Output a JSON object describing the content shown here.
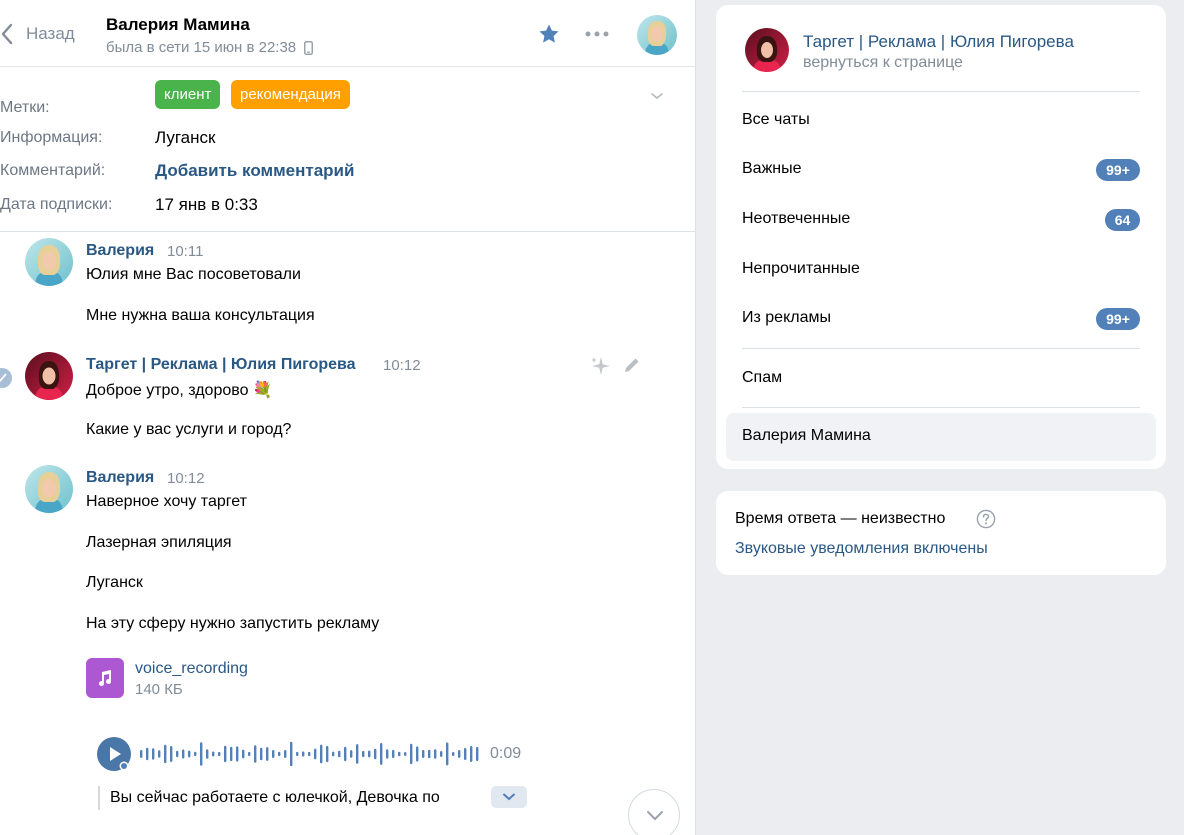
{
  "header": {
    "back_label": "Назад",
    "peer_name": "Валерия Мамина",
    "peer_status": "была в сети 15 июн в 22:38"
  },
  "meta": {
    "tags_label": "Метки:",
    "tags": [
      {
        "label": "клиент",
        "color": "#4bb34b"
      },
      {
        "label": "рекомендация",
        "color": "#ffa000"
      }
    ],
    "info_label": "Информация:",
    "info_value": "Луганск",
    "comment_label": "Комментарий:",
    "comment_link": "Добавить комментарий",
    "date_label": "Дата подписки:",
    "date_value": "17 янв в 0:33"
  },
  "messages": [
    {
      "author": "Валерия",
      "time": "10:11",
      "lines": [
        "Юлия мне Вас посоветовали",
        "Мне нужна ваша консультация"
      ]
    },
    {
      "author": "Таргет | Реклама | Юлия Пигорева",
      "time": "10:12",
      "lines": [
        "Доброе утро, здорово 💐",
        "Какие у вас услуги и город?"
      ]
    },
    {
      "author": "Валерия",
      "time": "10:12",
      "lines": [
        "Наверное хочу таргет",
        "Лазерная эпиляция",
        "Луганск",
        "На эту сферу нужно запустить рекламу"
      ],
      "attachment": {
        "name": "voice_recording",
        "size": "140 КБ",
        "icon": "music-note-icon"
      },
      "voice": {
        "duration": "0:09",
        "transcript": "Вы сейчас работаете с юлечкой, Девочка по"
      }
    }
  ],
  "sidebar": {
    "group_name": "Таргет | Реклама | Юлия Пигорева",
    "group_back": "вернуться к странице",
    "folders": [
      {
        "label": "Все чаты",
        "badge": ""
      },
      {
        "label": "Важные",
        "badge": "99+"
      },
      {
        "label": "Неотвеченные",
        "badge": "64"
      },
      {
        "label": "Непрочитанные",
        "badge": ""
      },
      {
        "label": "Из рекламы",
        "badge": "99+"
      },
      {
        "label": "Спам",
        "badge": ""
      },
      {
        "label": "Валерия Мамина",
        "badge": ""
      }
    ]
  },
  "response": {
    "text": "Время ответа — неизвестно",
    "sound_link": "Звуковые уведомления включены"
  },
  "colors": {
    "accent": "#5181b8",
    "link": "#2a5885",
    "secondary_text": "#818c99",
    "tag_client": "#4bb34b",
    "tag_recommendation": "#ffa000",
    "audio_icon": "#ad58d3"
  }
}
